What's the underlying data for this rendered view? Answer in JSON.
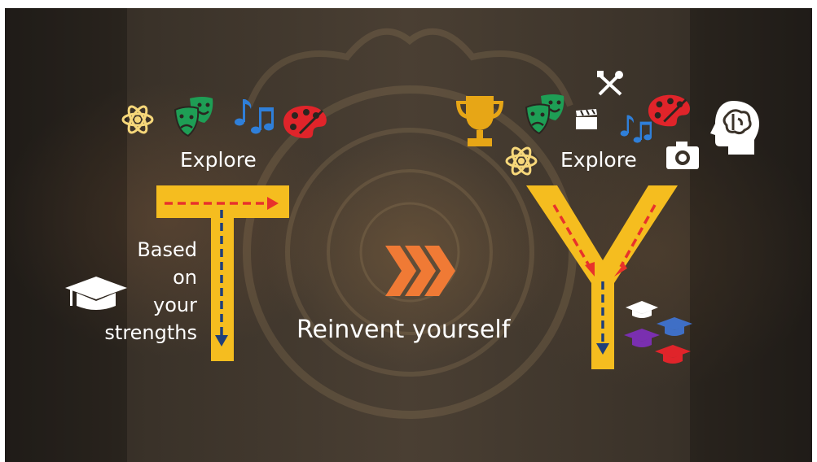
{
  "left": {
    "explore_label": "Explore",
    "strengths_label": [
      "Based",
      "on",
      "your",
      "strengths"
    ],
    "letter": "T",
    "icons": [
      "atom-icon",
      "theater-masks-icon",
      "music-notes-icon",
      "palette-icon",
      "graduation-cap-icon"
    ]
  },
  "center": {
    "reinvent_label": "Reinvent yourself",
    "icon": "triple-chevron-right-icon"
  },
  "right": {
    "explore_label": "Explore",
    "letter": "Y",
    "icons": [
      "trophy-icon",
      "theater-masks-icon",
      "clapperboard-icon",
      "tools-icon",
      "music-notes-icon",
      "palette-icon",
      "camera-icon",
      "brain-head-icon",
      "atom-icon",
      "graduation-caps-icon"
    ]
  },
  "colors": {
    "letter_yellow": "#f5bd1f",
    "dash_red": "#e8322b",
    "dash_navy": "#1f3f7a",
    "chevron_orange": "#f07a35",
    "mask_green": "#1e9e55",
    "music_blue": "#2f7fd9",
    "palette_red": "#e0242a",
    "trophy_gold": "#e7a616",
    "atom_yellow": "#f6d77a"
  }
}
